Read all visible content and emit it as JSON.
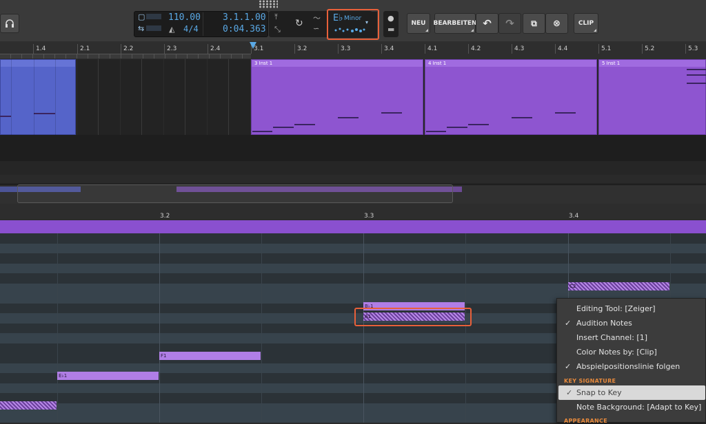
{
  "toolbar": {
    "tempo": "110.00",
    "time_signature": "4/4",
    "position_beats": "3.1.1.00",
    "position_time": "0:04.363",
    "key_root": "E♭",
    "key_mode": "Minor",
    "buttons": {
      "new": "NEU",
      "edit": "BEARBEITEN",
      "clip": "CLIP"
    },
    "icons": [
      "loop-icon",
      "metronome-icon",
      "undo-icon",
      "redo-icon",
      "copy-icon",
      "close-circle-icon",
      "record-dot-icon",
      "folder-icon",
      "headphones-icon",
      "grip-icon"
    ]
  },
  "arrange_ruler": {
    "labels": [
      "1.4",
      "2.1",
      "2.2",
      "2.3",
      "2.4",
      "3.1",
      "3.2",
      "3.3",
      "3.4",
      "4.1",
      "4.2",
      "4.3",
      "4.4",
      "5.1",
      "5.2",
      "5.3"
    ]
  },
  "clips": [
    {
      "label": "3 Inst 1"
    },
    {
      "label": "4 Inst 1"
    },
    {
      "label": "5 Inst 1"
    }
  ],
  "pianoroll": {
    "ruler_labels": [
      "3.2",
      "3.3",
      "3.4"
    ],
    "notes": [
      {
        "label": ""
      },
      {
        "label": "E♭1"
      },
      {
        "label": "F1"
      },
      {
        "label": "B♭1"
      },
      {
        "label": "A1"
      },
      {
        "label": "C2"
      }
    ]
  },
  "menu": {
    "items": [
      {
        "label": "Editing Tool: [Zeiger]",
        "checked": false
      },
      {
        "label": "Audition Notes",
        "checked": true
      },
      {
        "label": "Insert Channel: [1]",
        "checked": false
      },
      {
        "label": "Color Notes by: [Clip]",
        "checked": false
      },
      {
        "label": "Abspielpositionslinie folgen",
        "checked": true
      }
    ],
    "section_key": "KEY SIGNATURE",
    "key_items": [
      {
        "label": "Snap to Key",
        "checked": true
      },
      {
        "label": "Note Background: [Adapt to Key]",
        "checked": false
      }
    ],
    "section_appearance": "APPEARANCE"
  },
  "colors": {
    "clip_purple": "#8e55d0",
    "clip_blue": "#5564c9",
    "highlight": "#e8603a",
    "lcd_text": "#5aa9e6"
  }
}
